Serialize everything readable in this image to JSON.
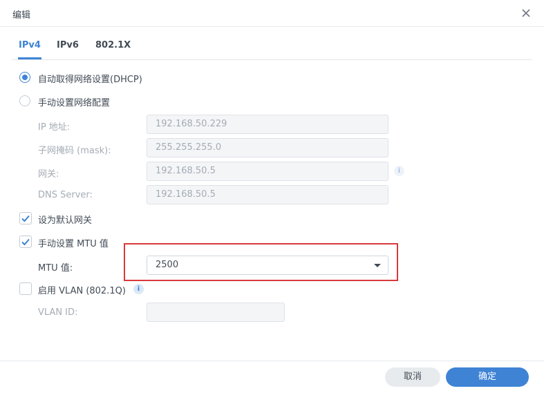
{
  "dialog": {
    "title": "编辑"
  },
  "tabs": [
    {
      "label": "IPv4",
      "active": true
    },
    {
      "label": "IPv6",
      "active": false
    },
    {
      "label": "802.1X",
      "active": false
    }
  ],
  "ipv4": {
    "dhcp_label": "自动取得网络设置(DHCP)",
    "dhcp_selected": true,
    "manual_label": "手动设置网络配置",
    "manual_selected": false,
    "ip_label": "IP 地址:",
    "ip_value": "192.168.50.229",
    "mask_label": "子网掩码 (mask):",
    "mask_value": "255.255.255.0",
    "gateway_label": "网关:",
    "gateway_value": "192.168.50.5",
    "dns_label": "DNS Server:",
    "dns_value": "192.168.50.5",
    "default_gateway_label": "设为默认网关",
    "default_gateway_checked": true,
    "manual_mtu_label": "手动设置 MTU 值",
    "manual_mtu_checked": true,
    "mtu_label": "MTU 值:",
    "mtu_value": "2500",
    "vlan_label": "启用 VLAN (802.1Q)",
    "vlan_checked": false,
    "vlan_id_label": "VLAN ID:",
    "vlan_id_value": ""
  },
  "footer": {
    "cancel_label": "取消",
    "ok_label": "确定"
  },
  "colors": {
    "accent": "#3f83d5",
    "highlight": "#d9393b",
    "disabled_text": "#a4acb5"
  }
}
